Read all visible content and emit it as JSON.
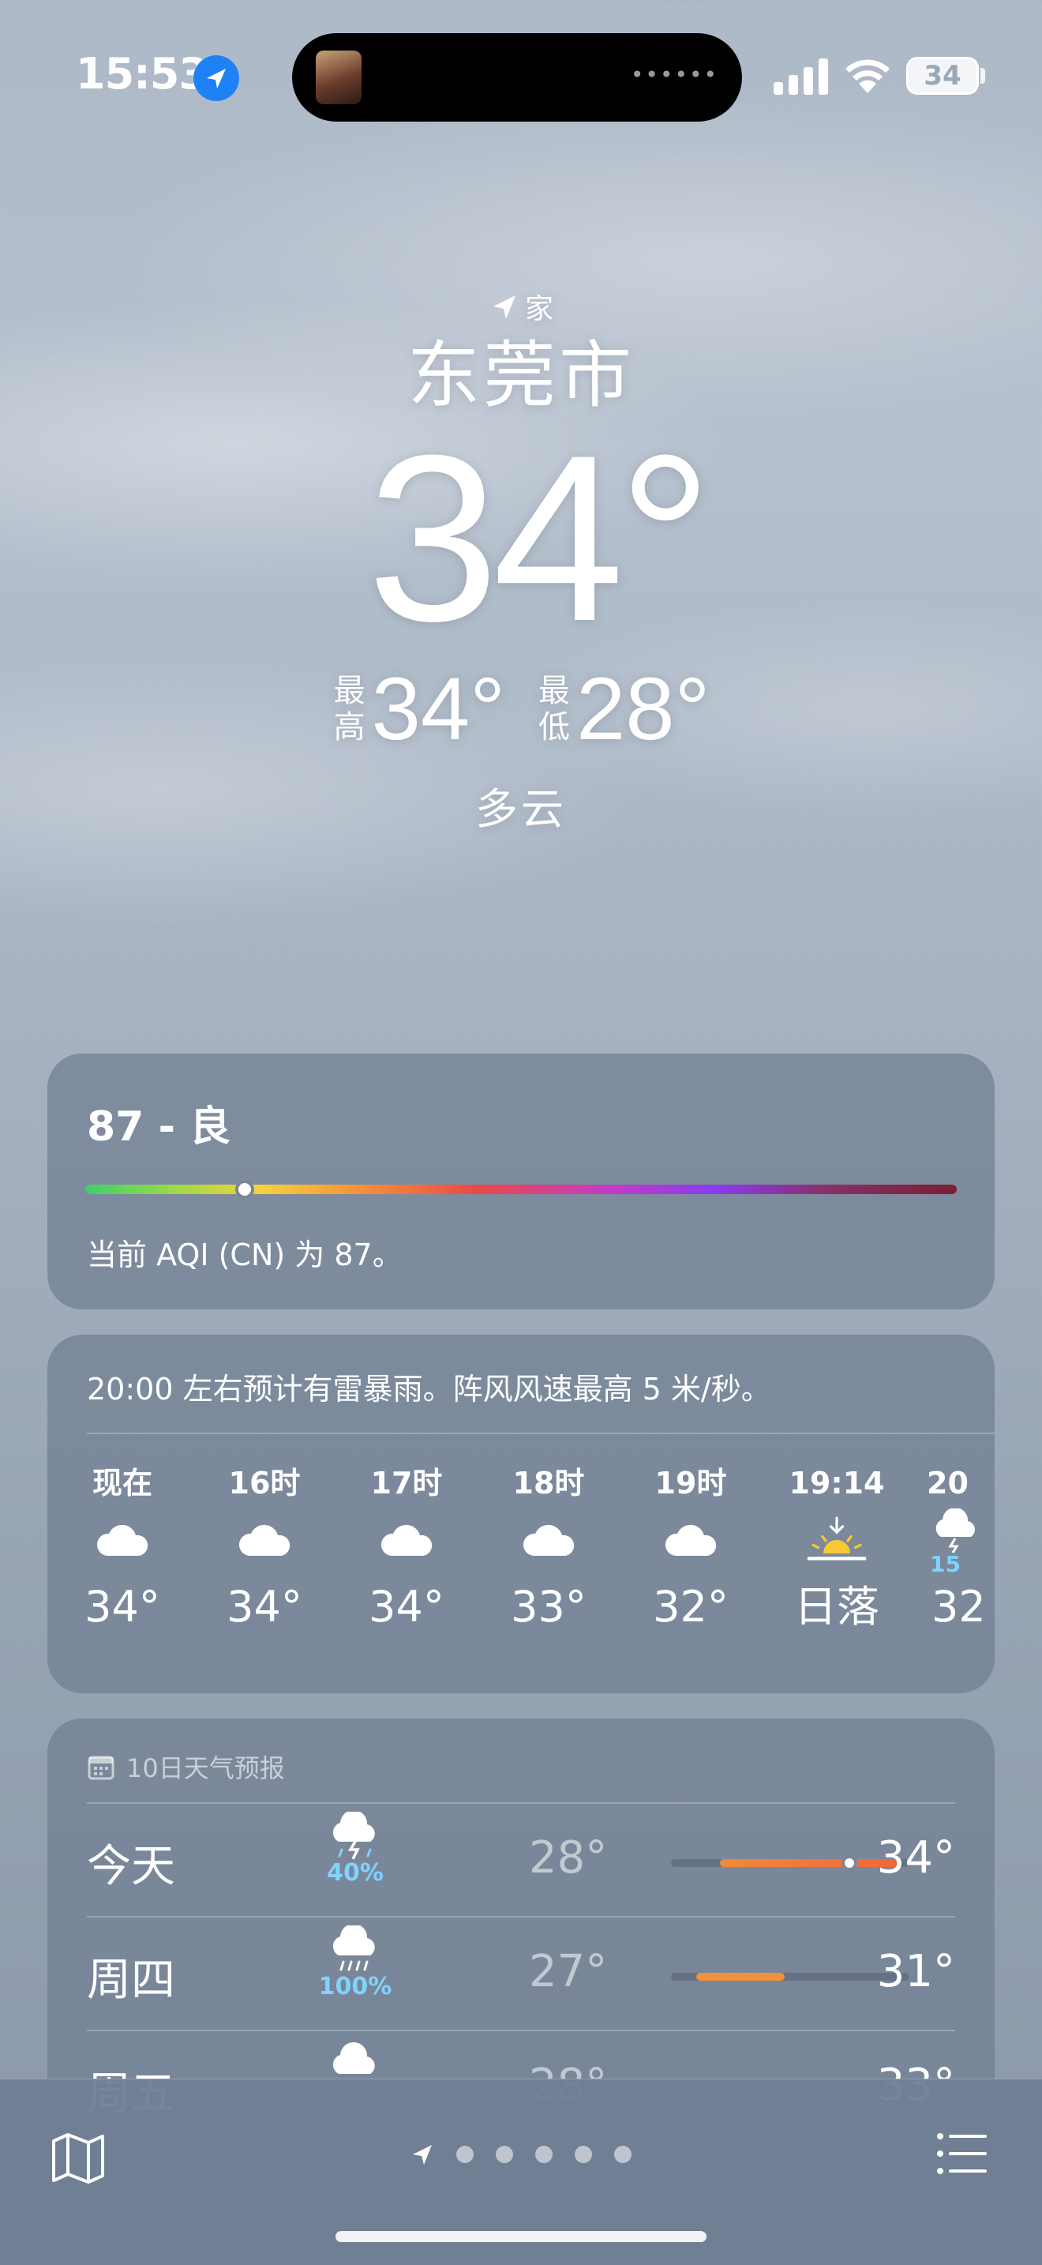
{
  "status_bar": {
    "time": "15:53",
    "battery": "34"
  },
  "header": {
    "location_label": "家",
    "city": "东莞市",
    "temperature": "34°",
    "high_label": "最高",
    "high": "34°",
    "low_label": "最低",
    "low": "28°",
    "condition": "多云"
  },
  "aqi": {
    "title": "87 - 良",
    "value": 87,
    "description": "当前 AQI (CN) 为 87。"
  },
  "hourly": {
    "summary": "20:00 左右预计有雷暴雨。阵风风速最高 5 米/秒。",
    "items": [
      {
        "label": "现在",
        "icon": "cloud-icon",
        "temp": "34°"
      },
      {
        "label": "16时",
        "icon": "cloud-icon",
        "temp": "34°"
      },
      {
        "label": "17时",
        "icon": "cloud-icon",
        "temp": "34°"
      },
      {
        "label": "18时",
        "icon": "cloud-icon",
        "temp": "33°"
      },
      {
        "label": "19时",
        "icon": "cloud-icon",
        "temp": "32°"
      },
      {
        "label": "19:14",
        "icon": "sunset-icon",
        "temp": "日落"
      },
      {
        "label": "20",
        "icon": "thunderstorm-icon",
        "pct": "15",
        "temp": "32"
      }
    ]
  },
  "daily": {
    "header": "10日天气预报",
    "days": [
      {
        "name": "今天",
        "icon": "thunderstorm-icon",
        "pct": "40%",
        "low": "28°",
        "high": "34°"
      },
      {
        "name": "周四",
        "icon": "rain-icon",
        "pct": "100%",
        "low": "27°",
        "high": "31°"
      },
      {
        "name": "周五",
        "icon": "cloud-icon",
        "pct": "",
        "low": "28°",
        "high": "33°"
      }
    ]
  },
  "colors": {
    "location_badge": "#1e82f5",
    "precip_text": "#7fd3ff",
    "temp_bar": "#f08a3a",
    "sunset_sun": "#f7c934"
  }
}
